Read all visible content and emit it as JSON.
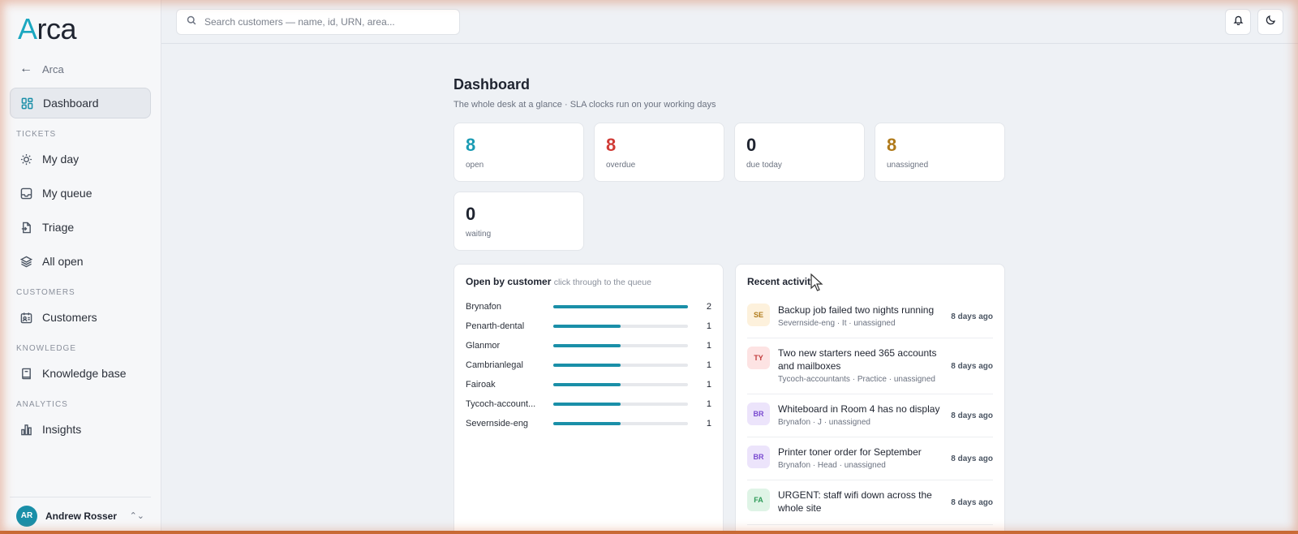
{
  "brand": {
    "logo_a": "A",
    "logo_rest": "rca"
  },
  "sidebar": {
    "back_label": "Arca",
    "dashboard": "Dashboard",
    "sections": {
      "tickets": "TICKETS",
      "customers": "CUSTOMERS",
      "knowledge": "KNOWLEDGE",
      "analytics": "ANALYTICS"
    },
    "items": {
      "my_day": "My day",
      "my_queue": "My queue",
      "triage": "Triage",
      "all_open": "All open",
      "customers": "Customers",
      "knowledge_base": "Knowledge base",
      "insights": "Insights"
    },
    "user": {
      "initials": "AR",
      "name": "Andrew Rosser"
    }
  },
  "search": {
    "placeholder": "Search customers — name, id, URN, area..."
  },
  "page": {
    "title": "Dashboard",
    "subtitle": "The whole desk at a glance · SLA clocks run on your working days"
  },
  "stats": [
    {
      "value": "8",
      "label": "open",
      "color": "#1a9bb3"
    },
    {
      "value": "8",
      "label": "overdue",
      "color": "#d03a35"
    },
    {
      "value": "0",
      "label": "due today",
      "color": "#1f2430"
    },
    {
      "value": "8",
      "label": "unassigned",
      "color": "#b07a1a"
    },
    {
      "value": "0",
      "label": "waiting",
      "color": "#1f2430"
    }
  ],
  "open_by_customer": {
    "title": "Open by customer",
    "hint": "click through to the queue",
    "max": 2,
    "rows": [
      {
        "name": "Brynafon",
        "count": 2
      },
      {
        "name": "Penarth-dental",
        "count": 1
      },
      {
        "name": "Glanmor",
        "count": 1
      },
      {
        "name": "Cambrianlegal",
        "count": 1
      },
      {
        "name": "Fairoak",
        "count": 1
      },
      {
        "name": "Tycoch-account...",
        "count": 1
      },
      {
        "name": "Severnside-eng",
        "count": 1
      }
    ]
  },
  "recent_activity": {
    "title": "Recent activity",
    "items": [
      {
        "badge": "SE",
        "bg": "#fdf1dc",
        "fg": "#b07a1a",
        "title": "Backup job failed two nights running",
        "meta": "Severnside-eng · It · unassigned",
        "time": "8 days ago"
      },
      {
        "badge": "TY",
        "bg": "#fde3e3",
        "fg": "#c23b3b",
        "title": "Two new starters need 365 accounts and mailboxes",
        "meta": "Tycoch-accountants · Practice · unassigned",
        "time": "8 days ago"
      },
      {
        "badge": "BR",
        "bg": "#ece4fb",
        "fg": "#7a4bd0",
        "title": "Whiteboard in Room 4 has no display",
        "meta": "Brynafon · J · unassigned",
        "time": "8 days ago"
      },
      {
        "badge": "BR",
        "bg": "#ece4fb",
        "fg": "#7a4bd0",
        "title": "Printer toner order for September",
        "meta": "Brynafon · Head · unassigned",
        "time": "8 days ago"
      },
      {
        "badge": "FA",
        "bg": "#dff4e6",
        "fg": "#2e9a58",
        "title": "URGENT: staff wifi down across the whole site",
        "meta": "",
        "time": "8 days ago"
      }
    ]
  }
}
